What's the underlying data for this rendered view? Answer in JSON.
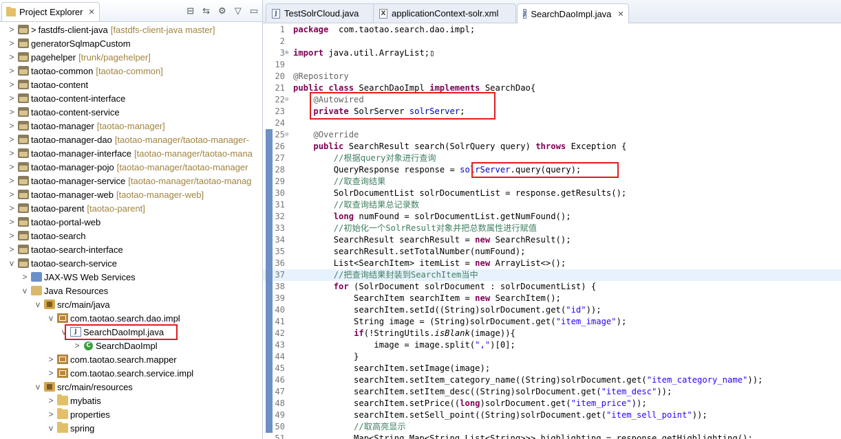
{
  "explorer": {
    "title": "Project Explorer",
    "tree": [
      {
        "indent": 0,
        "twisty": ">",
        "icon": "project",
        "arrow": ">",
        "label": "fastdfs-client-java",
        "deco": "[fastdfs-client-java master]"
      },
      {
        "indent": 0,
        "twisty": ">",
        "icon": "project",
        "label": "generatorSqlmapCustom",
        "deco": ""
      },
      {
        "indent": 0,
        "twisty": ">",
        "icon": "project",
        "label": "pagehelper",
        "deco": "[trunk/pagehelper]"
      },
      {
        "indent": 0,
        "twisty": ">",
        "icon": "project",
        "label": "taotao-common",
        "deco": "[taotao-common]"
      },
      {
        "indent": 0,
        "twisty": ">",
        "icon": "project",
        "label": "taotao-content",
        "deco": ""
      },
      {
        "indent": 0,
        "twisty": ">",
        "icon": "project",
        "label": "taotao-content-interface",
        "deco": ""
      },
      {
        "indent": 0,
        "twisty": ">",
        "icon": "project",
        "label": "taotao-content-service",
        "deco": ""
      },
      {
        "indent": 0,
        "twisty": ">",
        "icon": "project",
        "label": "taotao-manager",
        "deco": "[taotao-manager]"
      },
      {
        "indent": 0,
        "twisty": ">",
        "icon": "project",
        "label": "taotao-manager-dao",
        "deco": "[taotao-manager/taotao-manager-"
      },
      {
        "indent": 0,
        "twisty": ">",
        "icon": "project",
        "label": "taotao-manager-interface",
        "deco": "[taotao-manager/taotao-mana"
      },
      {
        "indent": 0,
        "twisty": ">",
        "icon": "project",
        "label": "taotao-manager-pojo",
        "deco": "[taotao-manager/taotao-manager"
      },
      {
        "indent": 0,
        "twisty": ">",
        "icon": "project",
        "label": "taotao-manager-service",
        "deco": "[taotao-manager/taotao-manag"
      },
      {
        "indent": 0,
        "twisty": ">",
        "icon": "project",
        "label": "taotao-manager-web",
        "deco": "[taotao-manager-web]"
      },
      {
        "indent": 0,
        "twisty": ">",
        "icon": "project",
        "label": "taotao-parent",
        "deco": "[taotao-parent]"
      },
      {
        "indent": 0,
        "twisty": ">",
        "icon": "project",
        "label": "taotao-portal-web",
        "deco": ""
      },
      {
        "indent": 0,
        "twisty": ">",
        "icon": "project",
        "label": "taotao-search",
        "deco": ""
      },
      {
        "indent": 0,
        "twisty": ">",
        "icon": "project",
        "label": "taotao-search-interface",
        "deco": ""
      },
      {
        "indent": 0,
        "twisty": "v",
        "icon": "project",
        "label": "taotao-search-service",
        "deco": ""
      },
      {
        "indent": 1,
        "twisty": ">",
        "icon": "jaxws",
        "label": "JAX-WS Web Services",
        "deco": ""
      },
      {
        "indent": 1,
        "twisty": "v",
        "icon": "javares",
        "label": "Java Resources",
        "deco": ""
      },
      {
        "indent": 2,
        "twisty": "v",
        "icon": "srcfolder",
        "label": "src/main/java",
        "deco": ""
      },
      {
        "indent": 3,
        "twisty": "v",
        "icon": "package",
        "label": "com.taotao.search.dao.impl",
        "deco": ""
      },
      {
        "indent": 4,
        "twisty": "v",
        "icon": "jfile",
        "label": "SearchDaoImpl.java",
        "deco": "",
        "selected": true
      },
      {
        "indent": 5,
        "twisty": ">",
        "icon": "class",
        "label": "SearchDaoImpl",
        "deco": ""
      },
      {
        "indent": 3,
        "twisty": ">",
        "icon": "package",
        "label": "com.taotao.search.mapper",
        "deco": ""
      },
      {
        "indent": 3,
        "twisty": ">",
        "icon": "package",
        "label": "com.taotao.search.service.impl",
        "deco": ""
      },
      {
        "indent": 2,
        "twisty": "v",
        "icon": "srcfolder",
        "label": "src/main/resources",
        "deco": ""
      },
      {
        "indent": 3,
        "twisty": ">",
        "icon": "folder",
        "label": "mybatis",
        "deco": ""
      },
      {
        "indent": 3,
        "twisty": ">",
        "icon": "folder",
        "label": "properties",
        "deco": ""
      },
      {
        "indent": 3,
        "twisty": "v",
        "icon": "folder",
        "label": "spring",
        "deco": ""
      }
    ]
  },
  "editor": {
    "tabs": [
      {
        "label": "TestSolrCloud.java",
        "icon": "J",
        "active": false
      },
      {
        "label": "applicationContext-solr.xml",
        "icon": "X",
        "active": false
      },
      {
        "label": "SearchDaoImpl.java",
        "icon": "J",
        "active": true
      }
    ],
    "lines": [
      {
        "n": "1",
        "fold": "",
        "code": [
          [
            "kw",
            "package"
          ],
          [
            "",
            "  com.taotao.search.dao.impl;"
          ]
        ]
      },
      {
        "n": "2",
        "fold": "",
        "code": []
      },
      {
        "n": "3",
        "fold": "⊕",
        "code": [
          [
            "kw",
            "import"
          ],
          [
            "",
            " java.util.ArrayList;"
          ],
          [
            "",
            "▯"
          ]
        ]
      },
      {
        "n": "19",
        "fold": "",
        "code": []
      },
      {
        "n": "20",
        "fold": "",
        "code": [
          [
            "ann",
            "@Repository"
          ]
        ]
      },
      {
        "n": "21",
        "fold": "",
        "code": [
          [
            "kw",
            "public class"
          ],
          [
            "",
            " SearchDaoImpl "
          ],
          [
            "kw",
            "implements"
          ],
          [
            "",
            " SearchDao{"
          ]
        ]
      },
      {
        "n": "22",
        "fold": "⊖",
        "code": [
          [
            "",
            "    "
          ],
          [
            "ann",
            "@Autowired"
          ]
        ]
      },
      {
        "n": "23",
        "fold": "",
        "code": [
          [
            "",
            "    "
          ],
          [
            "kw",
            "private"
          ],
          [
            "",
            " SolrServer "
          ],
          [
            "fld",
            "solrServer"
          ],
          [
            "",
            ";"
          ]
        ]
      },
      {
        "n": "24",
        "fold": "",
        "code": []
      },
      {
        "n": "25",
        "fold": "⊖",
        "code": [
          [
            "",
            "    "
          ],
          [
            "ann",
            "@Override"
          ]
        ]
      },
      {
        "n": "26",
        "fold": "",
        "code": [
          [
            "",
            "    "
          ],
          [
            "kw",
            "public"
          ],
          [
            "",
            " SearchResult search(SolrQuery query) "
          ],
          [
            "kw",
            "throws"
          ],
          [
            "",
            " Exception {"
          ]
        ]
      },
      {
        "n": "27",
        "fold": "",
        "code": [
          [
            "",
            "        "
          ],
          [
            "cmt",
            "//根据query对象进行查询"
          ]
        ]
      },
      {
        "n": "28",
        "fold": "",
        "code": [
          [
            "",
            "        QueryResponse response = "
          ],
          [
            "fld",
            "solrServer"
          ],
          [
            "",
            ".query(query);"
          ]
        ]
      },
      {
        "n": "29",
        "fold": "",
        "code": [
          [
            "",
            "        "
          ],
          [
            "cmt",
            "//取查询结果"
          ]
        ]
      },
      {
        "n": "30",
        "fold": "",
        "code": [
          [
            "",
            "        SolrDocumentList solrDocumentList = response.getResults();"
          ]
        ]
      },
      {
        "n": "31",
        "fold": "",
        "code": [
          [
            "",
            "        "
          ],
          [
            "cmt",
            "//取查询结果总记录数"
          ]
        ]
      },
      {
        "n": "32",
        "fold": "",
        "code": [
          [
            "",
            "        "
          ],
          [
            "kw",
            "long"
          ],
          [
            "",
            " numFound = solrDocumentList.getNumFound();"
          ]
        ]
      },
      {
        "n": "33",
        "fold": "",
        "code": [
          [
            "",
            "        "
          ],
          [
            "cmt",
            "//初始化一个SolrResult对象并把总数属性进行赋值"
          ]
        ]
      },
      {
        "n": "34",
        "fold": "",
        "code": [
          [
            "",
            "        SearchResult searchResult = "
          ],
          [
            "kw",
            "new"
          ],
          [
            "",
            " SearchResult();"
          ]
        ]
      },
      {
        "n": "35",
        "fold": "",
        "code": [
          [
            "",
            "        searchResult.setTotalNumber(numFound);"
          ]
        ]
      },
      {
        "n": "36",
        "fold": "",
        "code": [
          [
            "",
            "        List<SearchItem> itemList = "
          ],
          [
            "kw",
            "new"
          ],
          [
            "",
            " ArrayList<>();"
          ]
        ]
      },
      {
        "n": "37",
        "fold": "",
        "cur": true,
        "code": [
          [
            "",
            "        "
          ],
          [
            "cmt",
            "//把查询结果封装到SearchItem当中"
          ]
        ]
      },
      {
        "n": "38",
        "fold": "",
        "code": [
          [
            "",
            "        "
          ],
          [
            "kw",
            "for"
          ],
          [
            "",
            " (SolrDocument solrDocument : solrDocumentList) {"
          ]
        ]
      },
      {
        "n": "39",
        "fold": "",
        "code": [
          [
            "",
            "            SearchItem searchItem = "
          ],
          [
            "kw",
            "new"
          ],
          [
            "",
            " SearchItem();"
          ]
        ]
      },
      {
        "n": "40",
        "fold": "",
        "code": [
          [
            "",
            "            searchItem.setId((String)solrDocument.get("
          ],
          [
            "str",
            "\"id\""
          ],
          [
            "",
            "));"
          ]
        ]
      },
      {
        "n": "41",
        "fold": "",
        "code": [
          [
            "",
            "            String image = (String)solrDocument.get("
          ],
          [
            "str",
            "\"item_image\""
          ],
          [
            "",
            ");"
          ]
        ]
      },
      {
        "n": "42",
        "fold": "",
        "code": [
          [
            "",
            "            "
          ],
          [
            "kw",
            "if"
          ],
          [
            "",
            "(!StringUtils."
          ],
          [
            "ital",
            "isBlank"
          ],
          [
            "",
            "(image)){"
          ]
        ]
      },
      {
        "n": "43",
        "fold": "",
        "code": [
          [
            "",
            "                image = image.split("
          ],
          [
            "str",
            "\",\""
          ],
          [
            "",
            ")[0];"
          ]
        ]
      },
      {
        "n": "44",
        "fold": "",
        "code": [
          [
            "",
            "            }"
          ]
        ]
      },
      {
        "n": "45",
        "fold": "",
        "code": [
          [
            "",
            "            searchItem.setImage(image);"
          ]
        ]
      },
      {
        "n": "46",
        "fold": "",
        "code": [
          [
            "",
            "            searchItem.setItem_category_name((String)solrDocument.get("
          ],
          [
            "str",
            "\"item_category_name\""
          ],
          [
            "",
            "));"
          ]
        ]
      },
      {
        "n": "47",
        "fold": "",
        "code": [
          [
            "",
            "            searchItem.setItem_desc((String)solrDocument.get("
          ],
          [
            "str",
            "\"item_desc\""
          ],
          [
            "",
            "));"
          ]
        ]
      },
      {
        "n": "48",
        "fold": "",
        "code": [
          [
            "",
            "            searchItem.setPrice(("
          ],
          [
            "kw",
            "long"
          ],
          [
            "",
            ")solrDocument.get("
          ],
          [
            "str",
            "\"item_price\""
          ],
          [
            "",
            "));"
          ]
        ]
      },
      {
        "n": "49",
        "fold": "",
        "code": [
          [
            "",
            "            searchItem.setSell_point((String)solrDocument.get("
          ],
          [
            "str",
            "\"item_sell_point\""
          ],
          [
            "",
            "));"
          ]
        ]
      },
      {
        "n": "50",
        "fold": "",
        "code": [
          [
            "",
            "            "
          ],
          [
            "cmt",
            "//取高亮显示"
          ]
        ]
      },
      {
        "n": "51",
        "fold": "",
        "code": [
          [
            "",
            "            Map<String,Map<String,List<String>>> highlighting = response.getHighlighting();"
          ]
        ]
      }
    ]
  },
  "colors": {
    "annotation_box": "#e21b1b",
    "keyword": "#7f0055",
    "field": "#0000c0",
    "string": "#2a00ff",
    "comment": "#3f7f5f"
  }
}
